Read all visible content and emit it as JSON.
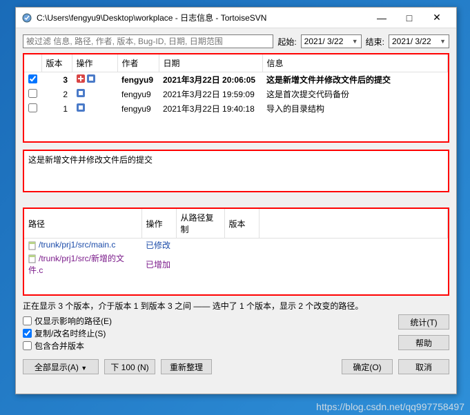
{
  "window": {
    "title": "C:\\Users\\fengyu9\\Desktop\\workplace - 日志信息 - TortoiseSVN"
  },
  "filter": {
    "placeholder": "被过滤 信息, 路径, 作者, 版本, Bug-ID, 日期, 日期范围",
    "from_label": "起始:",
    "from_date": "2021/ 3/22",
    "to_label": "结束:",
    "to_date": "2021/ 3/22"
  },
  "log": {
    "headers": {
      "rev": "版本",
      "action": "操作",
      "author": "作者",
      "date": "日期",
      "msg": "信息"
    },
    "rows": [
      {
        "checked": true,
        "rev": "3",
        "author": "fengyu9",
        "date": "2021年3月22日 20:06:05",
        "msg": "这是新增文件并修改文件后的提交",
        "selected": true,
        "icons": [
          "add",
          "modify"
        ]
      },
      {
        "checked": false,
        "rev": "2",
        "author": "fengyu9",
        "date": "2021年3月22日 19:59:09",
        "msg": "这是首次提交代码备份",
        "selected": false,
        "icons": [
          "modify"
        ]
      },
      {
        "checked": false,
        "rev": "1",
        "author": "fengyu9",
        "date": "2021年3月22日 19:40:18",
        "msg": "导入的目录结构",
        "selected": false,
        "icons": [
          "modify"
        ]
      }
    ]
  },
  "message": "这是新增文件并修改文件后的提交",
  "paths": {
    "headers": {
      "path": "路径",
      "action": "操作",
      "copyfrom": "从路径复制",
      "rev": "版本"
    },
    "rows": [
      {
        "path": "/trunk/prj1/src/main.c",
        "action": "已修改",
        "cls": "path-blue"
      },
      {
        "path": "/trunk/prj1/src/新增的文件.c",
        "action": "已增加",
        "cls": "path-purple"
      }
    ]
  },
  "summary": "正在显示 3 个版本，介于版本 1 到版本 3 之间 —— 选中了 1 个版本，显示 2 个改变的路径。",
  "options": {
    "affected": "仅显示影响的路径(E)",
    "stop_on_copy": "复制/改名时终止(S)",
    "include_merge": "包含合并版本"
  },
  "buttons": {
    "stats": "统计(T)",
    "help": "帮助",
    "show_all": "全部显示(A)",
    "next100": "下 100 (N)",
    "refresh": "重新整理",
    "ok": "确定(O)",
    "cancel": "取消"
  },
  "watermark": "https://blog.csdn.net/qq997758497"
}
